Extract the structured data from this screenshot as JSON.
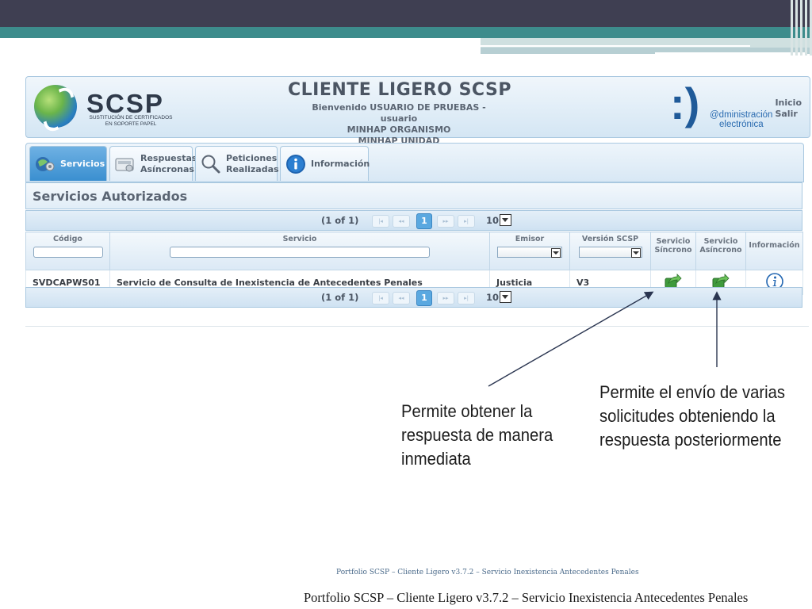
{
  "header": {
    "logo_text": "SCSP",
    "logo_subtitle_line1": "SUSTITUCIÓN DE CERTIFICADOS",
    "logo_subtitle_line2": "EN SOPORTE PAPEL",
    "title": "CLIENTE LIGERO SCSP",
    "welcome": "Bienvenido USUARIO DE PRUEBAS - usuario",
    "organismo": "MINHAP ORGANISMO",
    "unidad": "MINHAP UNIDAD",
    "admin_smile": ":)",
    "admin_line1": "@dministración",
    "admin_line2": "electrónica",
    "link_inicio": "Inicio",
    "link_salir": "Salir"
  },
  "tabs": [
    {
      "label": "Servicios",
      "active": true,
      "icon": "services-icon"
    },
    {
      "label_line1": "Respuestas",
      "label_line2": "Asíncronas",
      "icon": "inbox-icon"
    },
    {
      "label_line1": "Peticiones",
      "label_line2": "Realizadas",
      "icon": "search-icon"
    },
    {
      "label": "Información",
      "icon": "info-icon"
    }
  ],
  "section_title": "Servicios Autorizados",
  "paginator": {
    "count": "(1 of 1)",
    "first": "|◂",
    "prev": "◂◂",
    "current_page": "1",
    "next": "▸▸",
    "last": "▸|",
    "rows_per_page": "10"
  },
  "table": {
    "columns": {
      "codigo": "Código",
      "servicio": "Servicio",
      "emisor": "Emisor",
      "version": "Versión SCSP",
      "sync_line1": "Servicio",
      "sync_line2": "Síncrono",
      "async_line1": "Servicio",
      "async_line2": "Asíncrono",
      "info": "Información"
    },
    "rows": [
      {
        "codigo": "SVDCAPWS01",
        "servicio": "Servicio de Consulta de Inexistencia de Antecedentes Penales",
        "emisor": "Justicia",
        "version": "V3"
      }
    ]
  },
  "annotations": {
    "left": "Permite obtener la respuesta de manera inmediata",
    "right": "Permite el envío de varias solicitudes obteniendo la respuesta posteriormente"
  },
  "footer": {
    "small": "Portfolio SCSP – Cliente Ligero v3.7.2 – Servicio  Inexistencia Antecedentes Penales",
    "large": "Portfolio SCSP – Cliente Ligero v3.7.2 – Servicio  Inexistencia Antecedentes Penales"
  },
  "colors": {
    "top_band": "#3f3f52",
    "teal_band": "#3d8c8c",
    "active_tab": "#3a8fd0",
    "accent": "#1f5a99"
  }
}
